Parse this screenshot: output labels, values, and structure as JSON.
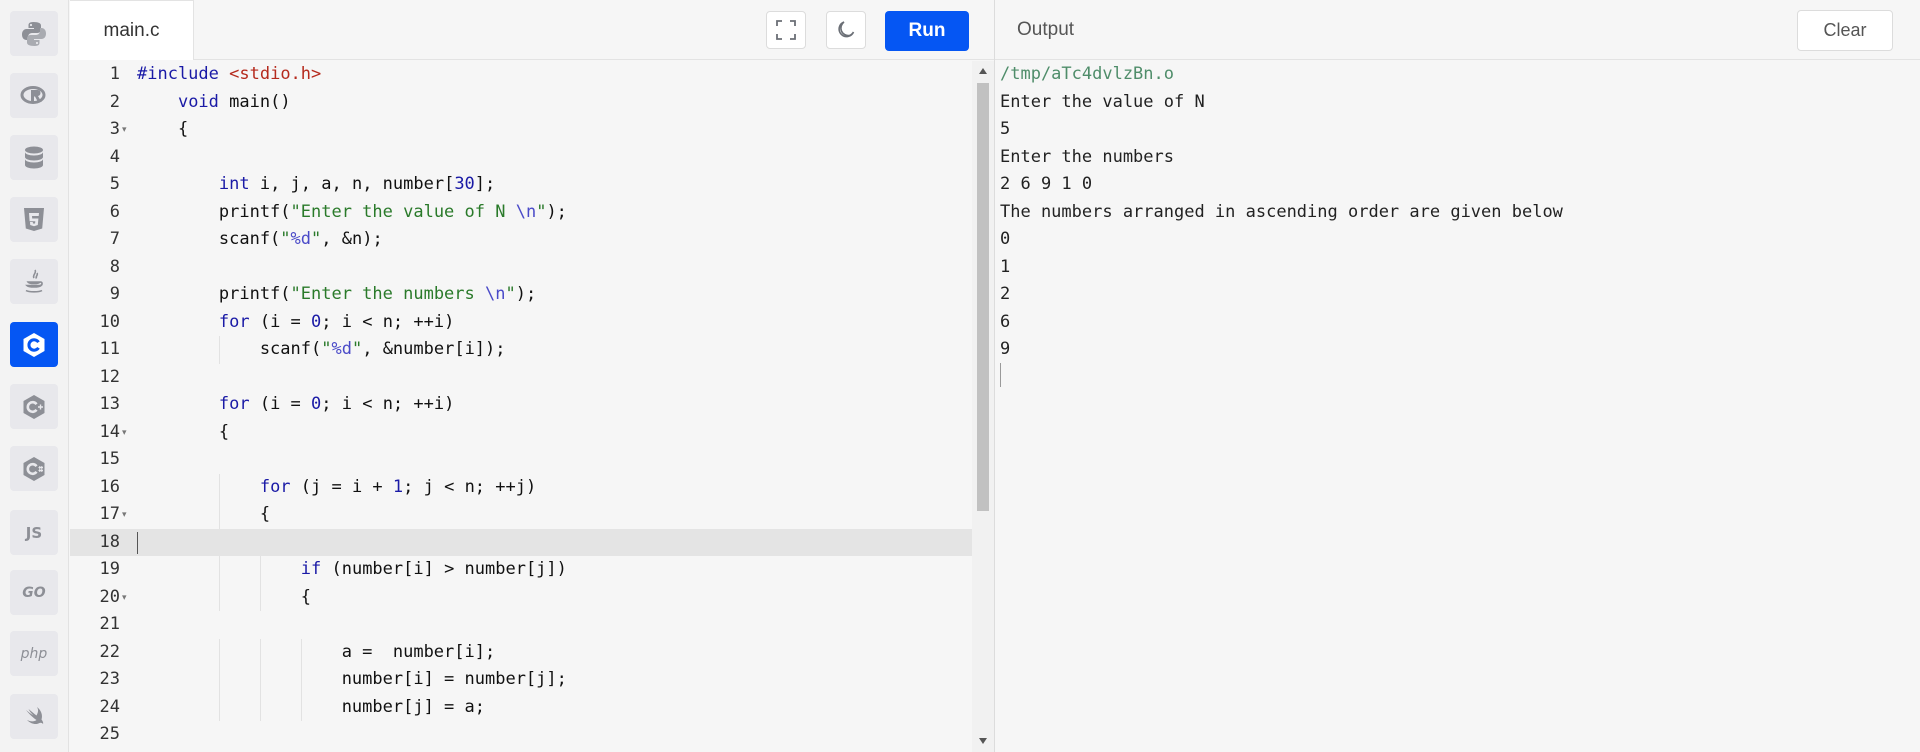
{
  "sidebar": {
    "languages": [
      {
        "name": "python-icon",
        "label": ""
      },
      {
        "name": "r-icon",
        "label": ""
      },
      {
        "name": "database-icon",
        "label": ""
      },
      {
        "name": "html5-icon",
        "label": ""
      },
      {
        "name": "java-icon",
        "label": ""
      },
      {
        "name": "c-icon",
        "label": "",
        "active": true
      },
      {
        "name": "cplusplus-icon",
        "label": ""
      },
      {
        "name": "csharp-icon",
        "label": ""
      },
      {
        "name": "javascript-icon",
        "label": "JS"
      },
      {
        "name": "go-icon",
        "label": "GO"
      },
      {
        "name": "php-icon",
        "label": "php"
      },
      {
        "name": "swift-icon",
        "label": ""
      }
    ]
  },
  "editor": {
    "file_name": "main.c",
    "fullscreen_icon": "fullscreen-icon",
    "theme_icon": "moon-icon",
    "run_label": "Run",
    "line_numbers": [
      "1",
      "2",
      "3",
      "4",
      "5",
      "6",
      "7",
      "8",
      "9",
      "10",
      "11",
      "12",
      "13",
      "14",
      "15",
      "16",
      "17",
      "18",
      "19",
      "20",
      "21",
      "22",
      "23",
      "24",
      "25"
    ],
    "lines": [
      "#include <stdio.h>",
      "    void main()",
      "    {",
      "",
      "        int i, j, a, n, number[30];",
      "        printf(\"Enter the value of N \\n\");",
      "        scanf(\"%d\", &n);",
      "",
      "        printf(\"Enter the numbers \\n\");",
      "        for (i = 0; i < n; ++i)",
      "            scanf(\"%d\", &number[i]);",
      "",
      "        for (i = 0; i < n; ++i)",
      "        {",
      "",
      "            for (j = i + 1; j < n; ++j)",
      "            {",
      "",
      "                if (number[i] > number[j])",
      "                {",
      "",
      "                    a =  number[i];",
      "                    number[i] = number[j];",
      "                    number[j] = a;",
      ""
    ],
    "fold_lines": [
      "3",
      "14",
      "17",
      "20"
    ],
    "active_line": "18"
  },
  "output": {
    "title": "Output",
    "clear_label": "Clear",
    "lines": [
      "/tmp/aTc4dvlzBn.o",
      "Enter the value of N",
      "5",
      "Enter the numbers",
      "2 6 9 1 0",
      "The numbers arranged in ascending order are given below",
      "0",
      "1",
      "2",
      "6",
      "9"
    ]
  },
  "colors": {
    "accent": "#0556f3",
    "keyword": "#1a1aa6",
    "string": "#2a7a2a",
    "include": "#b52a1d",
    "output_path": "#4f8d6a"
  }
}
